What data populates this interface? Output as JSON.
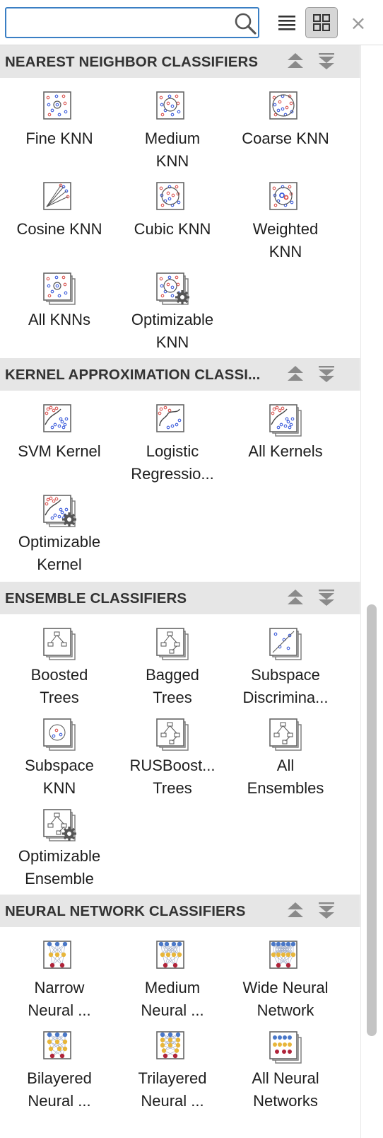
{
  "toolbar": {
    "search_value": "",
    "search_icon": "search-icon",
    "list_view_icon": "list-view-icon",
    "grid_view_icon": "grid-view-icon",
    "close_label": "×"
  },
  "sections": [
    {
      "title": "NEAREST NEIGHBOR CLASSIFIERS",
      "items": [
        {
          "label": "Fine KNN",
          "icon": "fine-knn-icon"
        },
        {
          "label": "Medium\nKNN",
          "icon": "medium-knn-icon"
        },
        {
          "label": "Coarse KNN",
          "icon": "coarse-knn-icon"
        },
        {
          "label": "Cosine KNN",
          "icon": "cosine-knn-icon"
        },
        {
          "label": "Cubic KNN",
          "icon": "cubic-knn-icon"
        },
        {
          "label": "Weighted\nKNN",
          "icon": "weighted-knn-icon"
        },
        {
          "label": "All KNNs",
          "icon": "all-knns-icon"
        },
        {
          "label": "Optimizable\nKNN",
          "icon": "optimizable-knn-icon"
        }
      ]
    },
    {
      "title": "KERNEL APPROXIMATION CLASSI...",
      "items": [
        {
          "label": "SVM Kernel",
          "icon": "svm-kernel-icon"
        },
        {
          "label": "Logistic\nRegressio...",
          "icon": "logistic-regression-kernel-icon"
        },
        {
          "label": "All Kernels",
          "icon": "all-kernels-icon"
        },
        {
          "label": "Optimizable\nKernel",
          "icon": "optimizable-kernel-icon"
        }
      ]
    },
    {
      "title": "ENSEMBLE CLASSIFIERS",
      "items": [
        {
          "label": "Boosted\nTrees",
          "icon": "boosted-trees-icon"
        },
        {
          "label": "Bagged\nTrees",
          "icon": "bagged-trees-icon"
        },
        {
          "label": "Subspace\nDiscrimina...",
          "icon": "subspace-discriminant-icon"
        },
        {
          "label": "Subspace\nKNN",
          "icon": "subspace-knn-icon"
        },
        {
          "label": "RUSBoost...\nTrees",
          "icon": "rusboosted-trees-icon"
        },
        {
          "label": "All\nEnsembles",
          "icon": "all-ensembles-icon"
        },
        {
          "label": "Optimizable\nEnsemble",
          "icon": "optimizable-ensemble-icon"
        }
      ]
    },
    {
      "title": "NEURAL NETWORK CLASSIFIERS",
      "items": [
        {
          "label": "Narrow\nNeural ...",
          "icon": "narrow-neural-network-icon"
        },
        {
          "label": "Medium\nNeural ...",
          "icon": "medium-neural-network-icon"
        },
        {
          "label": "Wide Neural\nNetwork",
          "icon": "wide-neural-network-icon"
        },
        {
          "label": "Bilayered\nNeural ...",
          "icon": "bilayered-neural-network-icon"
        },
        {
          "label": "Trilayered\nNeural ...",
          "icon": "trilayered-neural-network-icon"
        },
        {
          "label": "All Neural\nNetworks",
          "icon": "all-neural-networks-icon"
        }
      ]
    }
  ],
  "colors": {
    "accent": "#3a7fc4",
    "header_bg": "#e6e6e6",
    "point_red": "#d9534f",
    "point_blue": "#3b5bdb",
    "nn_blue": "#4a78c8",
    "nn_yellow": "#e8b63a",
    "nn_red": "#b0243a"
  }
}
